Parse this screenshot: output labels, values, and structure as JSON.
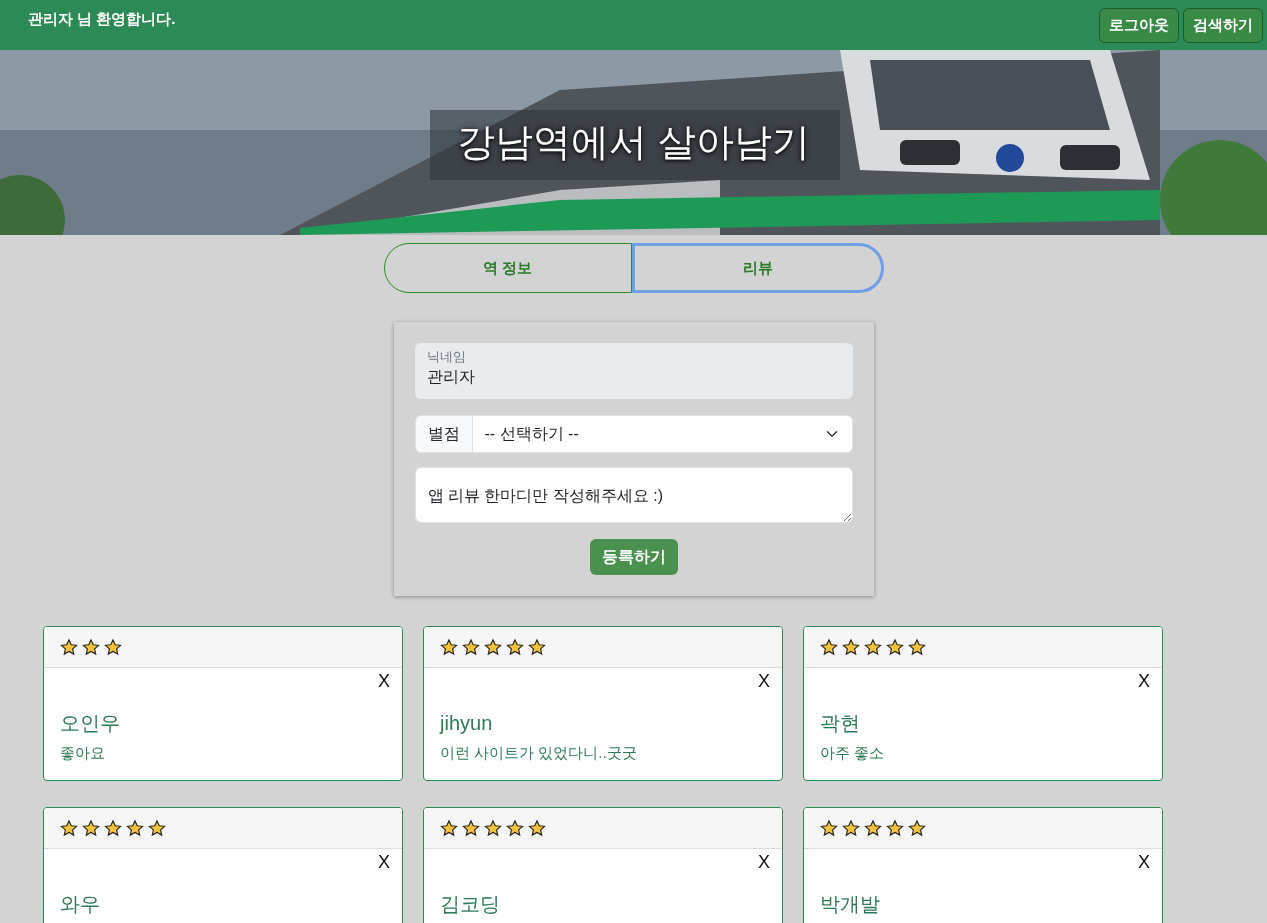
{
  "navbar": {
    "greeting": "관리자 님 환영합니다.",
    "buttons": [
      "로그아웃",
      "검색하기"
    ]
  },
  "hero": {
    "kind": "picture",
    "title": "강남역에서 살아남기"
  },
  "tabs": [
    {
      "label": "역 정보",
      "selected": false
    },
    {
      "label": "리뷰",
      "selected": true
    }
  ],
  "form": {
    "nickname": {
      "label": "닉네임",
      "value": "관리자",
      "disabled": true
    },
    "rating": {
      "label": "별점",
      "value": "-- 선택하기 --"
    },
    "comment": {
      "placeholder": "앱 리뷰 한마디만 작성해주세요 :)"
    },
    "submit": "등록하기"
  },
  "reviews": [
    {
      "stars": 3,
      "close": "X",
      "name": "오인우",
      "comment": "좋아요"
    },
    {
      "stars": 5,
      "close": "X",
      "name": "jihyun",
      "comment": "이런 사이트가 있었다니..굿굿"
    },
    {
      "stars": 5,
      "close": "X",
      "name": "곽현",
      "comment": "아주 좋소"
    },
    {
      "stars": 5,
      "close": "X",
      "name": "와우"
    },
    {
      "stars": 5,
      "close": "X",
      "name": "김코딩"
    },
    {
      "stars": 5,
      "close": "X",
      "name": "박개발"
    }
  ]
}
